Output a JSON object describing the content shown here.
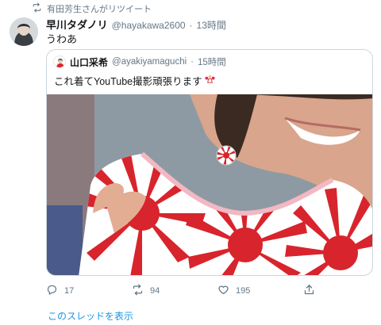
{
  "retweet_banner": {
    "text": "有田芳生さんがリツイート",
    "icon": "retweet-icon"
  },
  "tweet": {
    "display_name": "早川タダノリ",
    "handle": "@hayakawa2600",
    "separator": "·",
    "time": "13時間",
    "text": "うわあ"
  },
  "quoted_tweet": {
    "display_name": "山口采希",
    "handle": "@ayakiyamaguchi",
    "separator": "·",
    "time": "15時間",
    "text": "これ着てYouTube撮影頑張ります",
    "emoji": "cheerleader-emoji"
  },
  "actions": {
    "reply_count": "17",
    "retweet_count": "94",
    "like_count": "195",
    "icons": [
      "reply-icon",
      "retweet-icon",
      "heart-icon",
      "share-icon"
    ]
  },
  "thread_link": "このスレッドを表示",
  "colors": {
    "link": "#1b95e0",
    "muted": "#657786",
    "border": "#ccd6dd",
    "text": "#14171a",
    "shirt_red": "#d8242c"
  }
}
